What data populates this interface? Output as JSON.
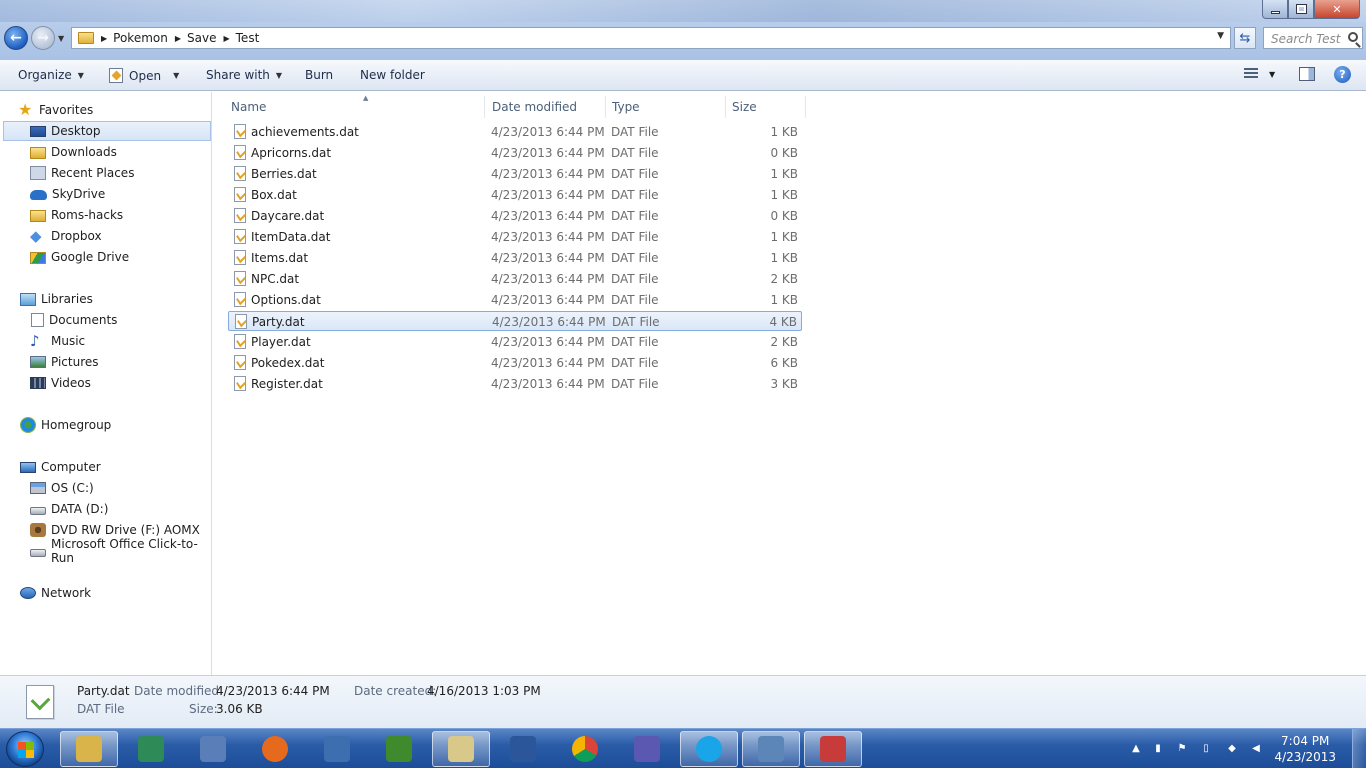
{
  "window": {
    "breadcrumb": [
      "Pokemon",
      "Save",
      "Test"
    ],
    "search_placeholder": "Search Test"
  },
  "toolbar": {
    "organize": "Organize",
    "open": "Open",
    "share_with": "Share with",
    "burn": "Burn",
    "new_folder": "New folder",
    "help": "?"
  },
  "nav": {
    "favorites": {
      "label": "Favorites",
      "items": [
        {
          "label": "Desktop",
          "icon": "desktop-icon"
        },
        {
          "label": "Downloads",
          "icon": "downloads-folder-icon"
        },
        {
          "label": "Recent Places",
          "icon": "recent-places-icon"
        },
        {
          "label": "SkyDrive",
          "icon": "skydrive-icon"
        },
        {
          "label": "Roms-hacks",
          "icon": "folder-icon"
        },
        {
          "label": "Dropbox",
          "icon": "dropbox-icon"
        },
        {
          "label": "Google Drive",
          "icon": "google-drive-icon"
        }
      ]
    },
    "libraries": {
      "label": "Libraries",
      "items": [
        {
          "label": "Documents",
          "icon": "documents-icon"
        },
        {
          "label": "Music",
          "icon": "music-icon"
        },
        {
          "label": "Pictures",
          "icon": "pictures-icon"
        },
        {
          "label": "Videos",
          "icon": "videos-icon"
        }
      ]
    },
    "homegroup": {
      "label": "Homegroup"
    },
    "computer": {
      "label": "Computer",
      "items": [
        {
          "label": "OS (C:)",
          "icon": "os-drive-icon"
        },
        {
          "label": "DATA (D:)",
          "icon": "drive-icon"
        },
        {
          "label": "DVD RW Drive (F:) AOMX",
          "icon": "dvd-drive-icon"
        },
        {
          "label": "Microsoft Office Click-to-Run",
          "icon": "drive-icon"
        }
      ]
    },
    "network": {
      "label": "Network"
    },
    "selected": "Desktop"
  },
  "columns": {
    "name": "Name",
    "date_modified": "Date modified",
    "type": "Type",
    "size": "Size"
  },
  "files": [
    {
      "name": "achievements.dat",
      "date": "4/23/2013 6:44 PM",
      "type": "DAT File",
      "size": "1 KB"
    },
    {
      "name": "Apricorns.dat",
      "date": "4/23/2013 6:44 PM",
      "type": "DAT File",
      "size": "0 KB"
    },
    {
      "name": "Berries.dat",
      "date": "4/23/2013 6:44 PM",
      "type": "DAT File",
      "size": "1 KB"
    },
    {
      "name": "Box.dat",
      "date": "4/23/2013 6:44 PM",
      "type": "DAT File",
      "size": "1 KB"
    },
    {
      "name": "Daycare.dat",
      "date": "4/23/2013 6:44 PM",
      "type": "DAT File",
      "size": "0 KB"
    },
    {
      "name": "ItemData.dat",
      "date": "4/23/2013 6:44 PM",
      "type": "DAT File",
      "size": "1 KB"
    },
    {
      "name": "Items.dat",
      "date": "4/23/2013 6:44 PM",
      "type": "DAT File",
      "size": "1 KB"
    },
    {
      "name": "NPC.dat",
      "date": "4/23/2013 6:44 PM",
      "type": "DAT File",
      "size": "2 KB"
    },
    {
      "name": "Options.dat",
      "date": "4/23/2013 6:44 PM",
      "type": "DAT File",
      "size": "1 KB"
    },
    {
      "name": "Party.dat",
      "date": "4/23/2013 6:44 PM",
      "type": "DAT File",
      "size": "4 KB",
      "selected": true
    },
    {
      "name": "Player.dat",
      "date": "4/23/2013 6:44 PM",
      "type": "DAT File",
      "size": "2 KB"
    },
    {
      "name": "Pokedex.dat",
      "date": "4/23/2013 6:44 PM",
      "type": "DAT File",
      "size": "6 KB"
    },
    {
      "name": "Register.dat",
      "date": "4/23/2013 6:44 PM",
      "type": "DAT File",
      "size": "3 KB"
    }
  ],
  "details": {
    "name": "Party.dat",
    "type": "DAT File",
    "date_modified_label": "Date modified:",
    "date_modified": "4/23/2013 6:44 PM",
    "size_label": "Size:",
    "size": "3.06 KB",
    "date_created_label": "Date created:",
    "date_created": "4/16/2013 1:03 PM"
  },
  "taskbar": {
    "apps": [
      {
        "name": "windows-explorer",
        "icon": "explorer-icon",
        "active": true
      },
      {
        "name": "media-app",
        "icon": "media-icon"
      },
      {
        "name": "windows-media-center",
        "icon": "media-center-icon"
      },
      {
        "name": "firefox",
        "icon": "firefox-icon"
      },
      {
        "name": "python",
        "icon": "python-icon"
      },
      {
        "name": "minecraft-tree-app",
        "icon": "tree-icon"
      },
      {
        "name": "notepad-plus-plus",
        "icon": "notepad-plus-plus-icon",
        "active": true
      },
      {
        "name": "microsoft-word",
        "icon": "word-icon"
      },
      {
        "name": "google-chrome",
        "icon": "chrome-icon"
      },
      {
        "name": "infinity-app",
        "icon": "infinity-icon"
      },
      {
        "name": "skype",
        "icon": "skype-icon",
        "active": true
      },
      {
        "name": "control-panel",
        "icon": "control-panel-icon",
        "active": true
      },
      {
        "name": "toolbox-app",
        "icon": "toolbox-icon",
        "active": true
      }
    ],
    "clock_time": "7:04 PM",
    "clock_date": "4/23/2013"
  },
  "colors": {
    "accent": "#1d5fc2",
    "selection": "#d9e7f8",
    "taskbar": "#2a5ca8"
  }
}
